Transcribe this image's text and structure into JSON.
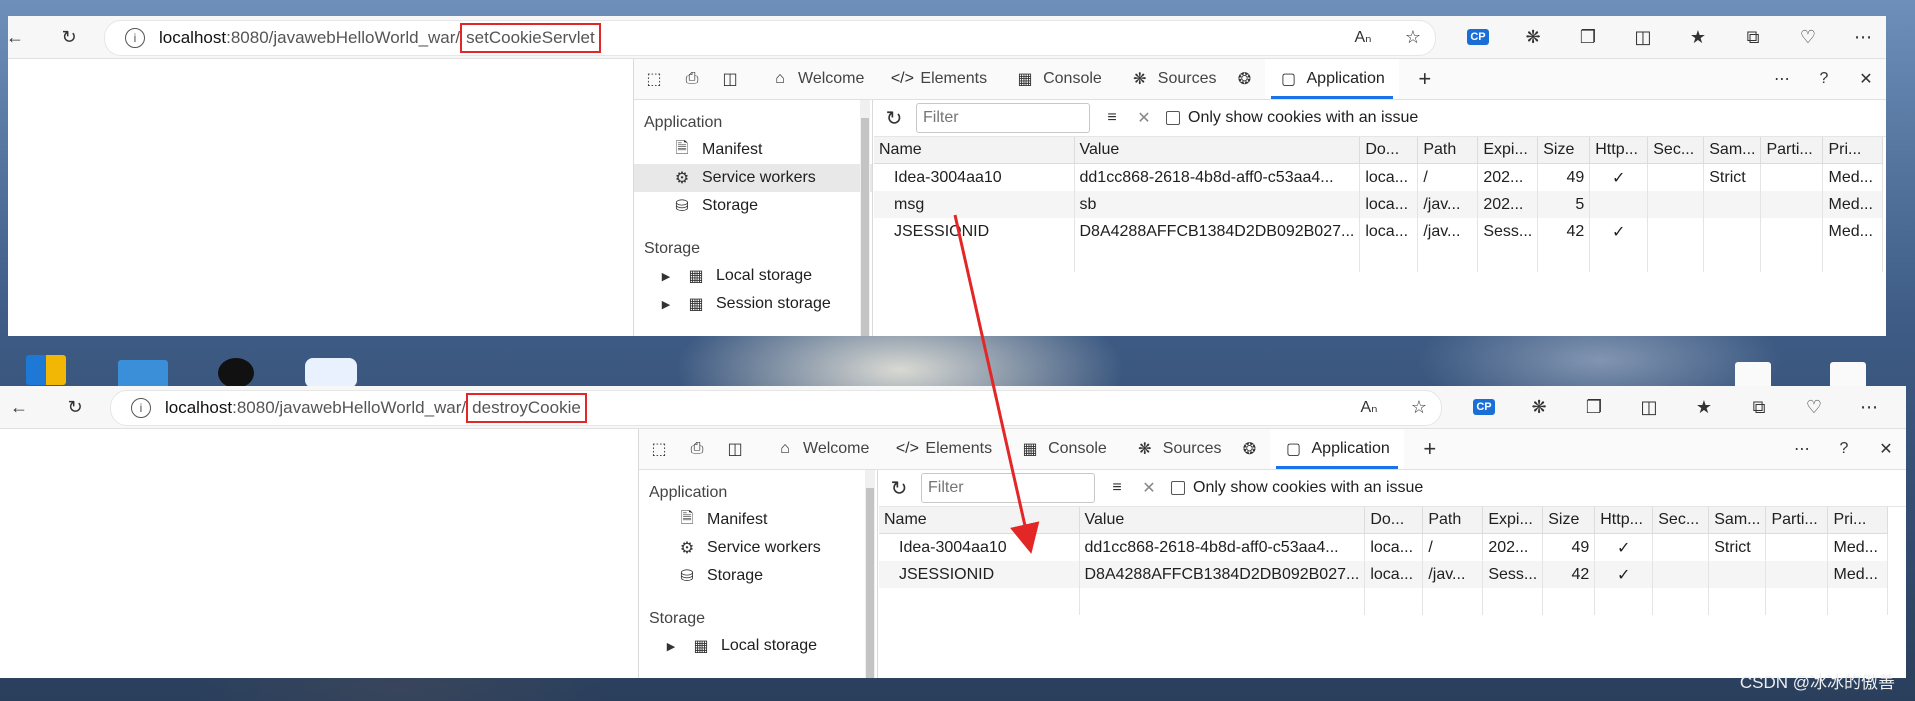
{
  "windows": [
    {
      "url": {
        "host": "localhost",
        "path_mid": ":8080/javawebHelloWorld_war/",
        "highlight": "setCookieServlet"
      },
      "tabs": [
        {
          "label": "Welcome"
        },
        {
          "label": "Elements"
        },
        {
          "label": "Console"
        },
        {
          "label": "Sources"
        },
        {
          "label": "Application"
        }
      ],
      "sidebar": {
        "section1": "Application",
        "items": [
          "Manifest",
          "Service workers",
          "Storage"
        ],
        "section2": "Storage",
        "storage_items": [
          "Local storage",
          "Session storage"
        ]
      },
      "toolbar": {
        "filter_placeholder": "Filter",
        "only_issue_label": "Only show cookies with an issue"
      },
      "columns": [
        "Name",
        "Value",
        "Do...",
        "Path",
        "Expi...",
        "Size",
        "Http...",
        "Sec...",
        "Sam...",
        "Parti...",
        "Pri..."
      ],
      "rows": [
        {
          "name": "Idea-3004aa10",
          "value": "dd1cc868-2618-4b8d-aff0-c53aa4...",
          "domain": "loca...",
          "path": "/",
          "expires": "202...",
          "size": "49",
          "http": "✓",
          "sec": "",
          "same": "Strict",
          "parti": "",
          "pri": "Med..."
        },
        {
          "name": "msg",
          "value": "sb",
          "domain": "loca...",
          "path": "/jav...",
          "expires": "202...",
          "size": "5",
          "http": "",
          "sec": "",
          "same": "",
          "parti": "",
          "pri": "Med..."
        },
        {
          "name": "JSESSIONID",
          "value": "D8A4288AFFCB1384D2DB092B027...",
          "domain": "loca...",
          "path": "/jav...",
          "expires": "Sess...",
          "size": "42",
          "http": "✓",
          "sec": "",
          "same": "",
          "parti": "",
          "pri": "Med..."
        }
      ]
    },
    {
      "url": {
        "host": "localhost",
        "path_mid": ":8080/javawebHelloWorld_war/",
        "highlight": "destroyCookie"
      },
      "tabs": [
        {
          "label": "Welcome"
        },
        {
          "label": "Elements"
        },
        {
          "label": "Console"
        },
        {
          "label": "Sources"
        },
        {
          "label": "Application"
        }
      ],
      "sidebar": {
        "section1": "Application",
        "items": [
          "Manifest",
          "Service workers",
          "Storage"
        ],
        "section2": "Storage",
        "storage_items": [
          "Local storage"
        ]
      },
      "toolbar": {
        "filter_placeholder": "Filter",
        "only_issue_label": "Only show cookies with an issue"
      },
      "columns": [
        "Name",
        "Value",
        "Do...",
        "Path",
        "Expi...",
        "Size",
        "Http...",
        "Sec...",
        "Sam...",
        "Parti...",
        "Pri..."
      ],
      "rows": [
        {
          "name": "Idea-3004aa10",
          "value": "dd1cc868-2618-4b8d-aff0-c53aa4...",
          "domain": "loca...",
          "path": "/",
          "expires": "202...",
          "size": "49",
          "http": "✓",
          "sec": "",
          "same": "Strict",
          "parti": "",
          "pri": "Med..."
        },
        {
          "name": "JSESSIONID",
          "value": "D8A4288AFFCB1384D2DB092B027...",
          "domain": "loca...",
          "path": "/jav...",
          "expires": "Sess...",
          "size": "42",
          "http": "✓",
          "sec": "",
          "same": "",
          "parti": "",
          "pri": "Med..."
        }
      ]
    }
  ],
  "watermark": "CSDN @冰冰的傲善",
  "colors": {
    "highlight_box": "#e32626",
    "arrow": "#e32626",
    "accent": "#1a73e8"
  }
}
